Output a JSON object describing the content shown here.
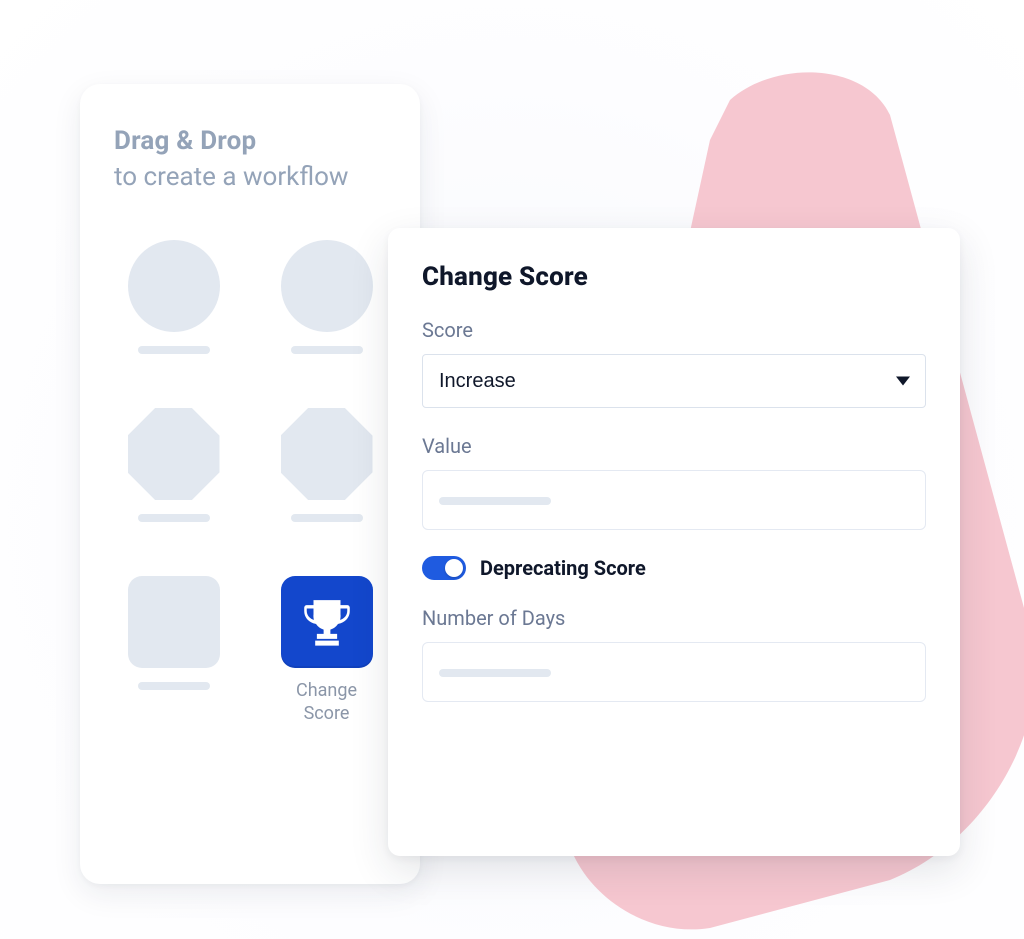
{
  "palette": {
    "title": "Drag & Drop",
    "subtitle": "to create a workflow",
    "change_score_label": "Change\nScore"
  },
  "config": {
    "title": "Change Score",
    "score_label": "Score",
    "score_value": "Increase",
    "value_label": "Value",
    "deprecating_label": "Deprecating Score",
    "deprecating_on": true,
    "days_label": "Number of Days"
  }
}
